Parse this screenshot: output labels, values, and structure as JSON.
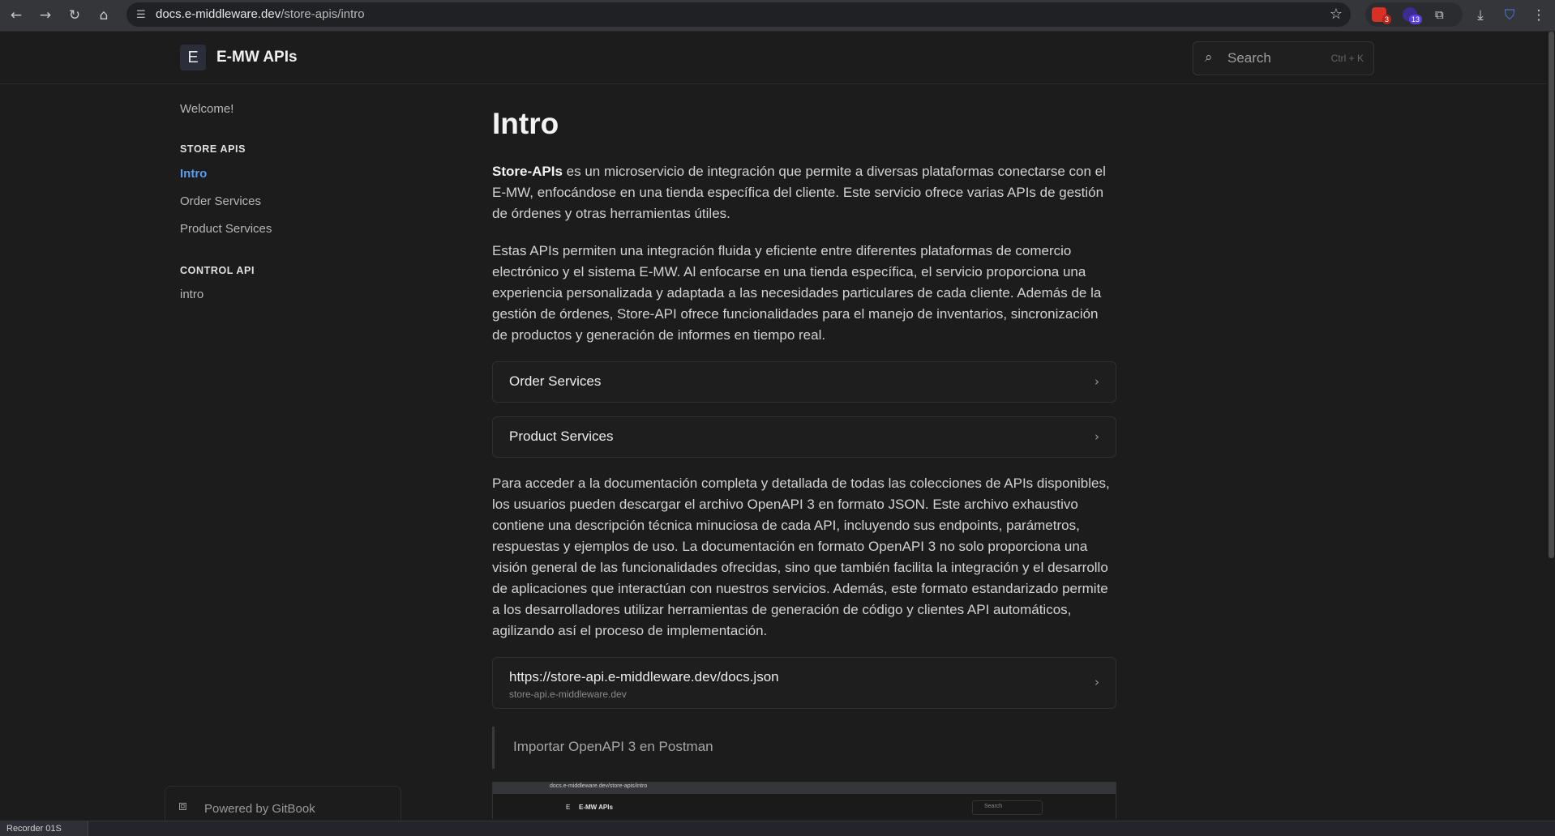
{
  "browser": {
    "url_host": "docs.e-middleware.dev",
    "url_path": "/store-apis/intro",
    "extensions": [
      {
        "name": "extension-1-icon",
        "badge": "3",
        "color": "#d93025"
      },
      {
        "name": "extension-2-icon",
        "badge": "13",
        "color": "#5b3fd8"
      }
    ]
  },
  "site": {
    "logo_letter": "E",
    "title": "E-MW APIs",
    "search_placeholder": "Search",
    "search_shortcut": "Ctrl + K"
  },
  "sidebar": {
    "welcome": "Welcome!",
    "section_store": "STORE APIS",
    "store_items": [
      "Intro",
      "Order Services",
      "Product Services"
    ],
    "section_control": "CONTROL API",
    "control_items": [
      "intro"
    ],
    "powered_by": "Powered by GitBook"
  },
  "main": {
    "title": "Intro",
    "p1_bold": "Store-APIs",
    "p1_rest": " es un microservicio de integración que permite a diversas plataformas conectarse con el E-MW, enfocándose en una tienda específica del cliente. Este servicio ofrece varias APIs de gestión de órdenes y otras herramientas útiles.",
    "p2": "Estas APIs permiten una integración fluida y eficiente entre diferentes plataformas de comercio electrónico y el sistema E-MW. Al enfocarse en una tienda específica, el servicio proporciona una experiencia personalizada y adaptada a las necesidades particulares de cada cliente. Además de la gestión de órdenes, Store-API ofrece funcionalidades para el manejo de inventarios, sincronización de productos y generación de informes en tiempo real.",
    "card_order": "Order Services",
    "card_product": "Product Services",
    "p3": "Para acceder a la documentación completa y detallada de todas las colecciones de APIs disponibles, los usuarios pueden descargar el archivo OpenAPI 3 en formato JSON. Este archivo exhaustivo contiene una descripción técnica minuciosa de cada API, incluyendo sus endpoints, parámetros, respuestas y ejemplos de uso. La documentación en formato OpenAPI 3 no solo proporciona una visión general de las funcionalidades ofrecidas, sino que también facilita la integración y el desarrollo de aplicaciones que interactúan con nuestros servicios. Además, este formato estandarizado permite a los desarrolladores utilizar herramientas de generación de código y clientes API automáticos, agilizando así el proceso de implementación.",
    "link_url": "https://store-api.e-middleware.dev/docs.json",
    "link_host": "store-api.e-middleware.dev",
    "quote": "Importar OpenAPI 3 en Postman"
  },
  "embed": {
    "url": "docs.e-middleware.dev/store-apis/intro",
    "logo_letter": "E",
    "title": "E-MW APIs",
    "search": "Search"
  },
  "taskbar": {
    "item_label": "Recorder 01S"
  }
}
